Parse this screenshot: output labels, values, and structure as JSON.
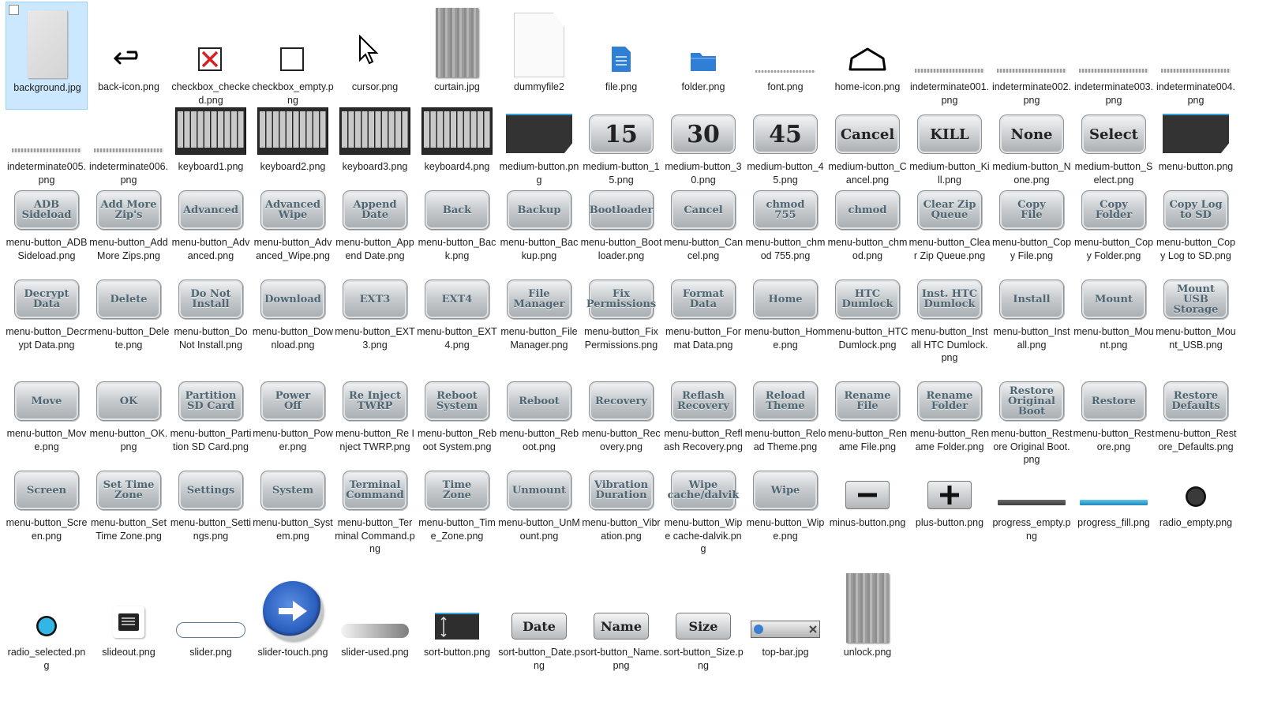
{
  "files": [
    {
      "name": "background.jpg",
      "kind": "gray-rect",
      "selected": true
    },
    {
      "name": "back-icon.png",
      "kind": "back-icon"
    },
    {
      "name": "checkbox_checked.png",
      "kind": "checkbox-checked"
    },
    {
      "name": "checkbox_empty.png",
      "kind": "checkbox-empty"
    },
    {
      "name": "cursor.png",
      "kind": "cursor"
    },
    {
      "name": "curtain.jpg",
      "kind": "curtain"
    },
    {
      "name": "dummyfile2",
      "kind": "doc"
    },
    {
      "name": "file.png",
      "kind": "file-icon"
    },
    {
      "name": "folder.png",
      "kind": "folder-icon"
    },
    {
      "name": "font.png",
      "kind": "font"
    },
    {
      "name": "home-icon.png",
      "kind": "home-icon"
    },
    {
      "name": "indeterminate001.png",
      "kind": "pattern"
    },
    {
      "name": "indeterminate002.png",
      "kind": "pattern"
    },
    {
      "name": "indeterminate003.png",
      "kind": "pattern"
    },
    {
      "name": "indeterminate004.png",
      "kind": "pattern"
    },
    {
      "name": "indeterminate005.png",
      "kind": "pattern"
    },
    {
      "name": "indeterminate006.png",
      "kind": "pattern"
    },
    {
      "name": "keyboard1.png",
      "kind": "keyboard"
    },
    {
      "name": "keyboard2.png",
      "kind": "keyboard"
    },
    {
      "name": "keyboard3.png",
      "kind": "keyboard"
    },
    {
      "name": "keyboard4.png",
      "kind": "keyboard"
    },
    {
      "name": "medium-button.png",
      "kind": "darkpanel"
    },
    {
      "name": "medium-button_15.png",
      "kind": "big",
      "text": "15"
    },
    {
      "name": "medium-button_30.png",
      "kind": "big",
      "text": "30"
    },
    {
      "name": "medium-button_45.png",
      "kind": "big",
      "text": "45"
    },
    {
      "name": "medium-button_Cancel.png",
      "kind": "big",
      "text": "Cancel"
    },
    {
      "name": "medium-button_Kill.png",
      "kind": "big",
      "text": "KILL"
    },
    {
      "name": "medium-button_None.png",
      "kind": "big",
      "text": "None"
    },
    {
      "name": "medium-button_Select.png",
      "kind": "big",
      "text": "Select"
    },
    {
      "name": "menu-button.png",
      "kind": "darkpanel"
    },
    {
      "name": "menu-button_ADB Sideload.png",
      "kind": "btn",
      "text": "ADB\nSideload"
    },
    {
      "name": "menu-button_Add More Zips.png",
      "kind": "btn",
      "text": "Add More\nZip's"
    },
    {
      "name": "menu-button_Advanced.png",
      "kind": "btn",
      "text": "Advanced"
    },
    {
      "name": "menu-button_Advanced_Wipe.png",
      "kind": "btn",
      "text": "Advanced\nWipe"
    },
    {
      "name": "menu-button_Append Date.png",
      "kind": "btn",
      "text": "Append\nDate"
    },
    {
      "name": "menu-button_Back.png",
      "kind": "btn",
      "text": "Back"
    },
    {
      "name": "menu-button_Backup.png",
      "kind": "btn",
      "text": "Backup"
    },
    {
      "name": "menu-button_Bootloader.png",
      "kind": "btn",
      "text": "Bootloader"
    },
    {
      "name": "menu-button_Cancel.png",
      "kind": "btn",
      "text": "Cancel"
    },
    {
      "name": "menu-button_chmod 755.png",
      "kind": "btn",
      "text": "chmod\n755"
    },
    {
      "name": "menu-button_chmod.png",
      "kind": "btn",
      "text": "chmod"
    },
    {
      "name": "menu-button_Clear Zip Queue.png",
      "kind": "btn",
      "text": "Clear Zip\nQueue"
    },
    {
      "name": "menu-button_Copy File.png",
      "kind": "btn",
      "text": "Copy\nFile"
    },
    {
      "name": "menu-button_Copy Folder.png",
      "kind": "btn",
      "text": "Copy\nFolder"
    },
    {
      "name": "menu-button_Copy Log to SD.png",
      "kind": "btn",
      "text": "Copy Log\nto SD"
    },
    {
      "name": "menu-button_Decrypt Data.png",
      "kind": "btn",
      "text": "Decrypt\nData"
    },
    {
      "name": "menu-button_Delete.png",
      "kind": "btn",
      "text": "Delete"
    },
    {
      "name": "menu-button_Do Not Install.png",
      "kind": "btn",
      "text": "Do Not\nInstall"
    },
    {
      "name": "menu-button_Download.png",
      "kind": "btn",
      "text": "Download"
    },
    {
      "name": "menu-button_EXT3.png",
      "kind": "btn",
      "text": "EXT3"
    },
    {
      "name": "menu-button_EXT4.png",
      "kind": "btn",
      "text": "EXT4"
    },
    {
      "name": "menu-button_File Manager.png",
      "kind": "btn",
      "text": "File\nManager"
    },
    {
      "name": "menu-button_Fix Permissions.png",
      "kind": "btn",
      "text": "Fix\nPermissions"
    },
    {
      "name": "menu-button_Format Data.png",
      "kind": "btn",
      "text": "Format\nData"
    },
    {
      "name": "menu-button_Home.png",
      "kind": "btn",
      "text": "Home"
    },
    {
      "name": "menu-button_HTC Dumlock.png",
      "kind": "btn",
      "text": "HTC\nDumlock"
    },
    {
      "name": "menu-button_Install HTC Dumlock.png",
      "kind": "btn",
      "text": "Inst. HTC\nDumlock"
    },
    {
      "name": "menu-button_Install.png",
      "kind": "btn",
      "text": "Install"
    },
    {
      "name": "menu-button_Mount.png",
      "kind": "btn",
      "text": "Mount"
    },
    {
      "name": "menu-button_Mount_USB.png",
      "kind": "btn",
      "text": "Mount\nUSB\nStorage"
    },
    {
      "name": "menu-button_Move.png",
      "kind": "btn",
      "text": "Move"
    },
    {
      "name": "menu-button_OK.png",
      "kind": "btn",
      "text": "OK"
    },
    {
      "name": "menu-button_Partition SD Card.png",
      "kind": "btn",
      "text": "Partition\nSD Card"
    },
    {
      "name": "menu-button_Power.png",
      "kind": "btn",
      "text": "Power\nOff"
    },
    {
      "name": "menu-button_Re Inject TWRP.png",
      "kind": "btn",
      "text": "Re Inject\nTWRP"
    },
    {
      "name": "menu-button_Reboot System.png",
      "kind": "btn",
      "text": "Reboot\nSystem"
    },
    {
      "name": "menu-button_Reboot.png",
      "kind": "btn",
      "text": "Reboot"
    },
    {
      "name": "menu-button_Recovery.png",
      "kind": "btn",
      "text": "Recovery"
    },
    {
      "name": "menu-button_Reflash Recovery.png",
      "kind": "btn",
      "text": "Reflash\nRecovery"
    },
    {
      "name": "menu-button_Reload Theme.png",
      "kind": "btn",
      "text": "Reload\nTheme"
    },
    {
      "name": "menu-button_Rename File.png",
      "kind": "btn",
      "text": "Rename\nFile"
    },
    {
      "name": "menu-button_Rename Folder.png",
      "kind": "btn",
      "text": "Rename\nFolder"
    },
    {
      "name": "menu-button_Restore Original Boot.png",
      "kind": "btn",
      "text": "Restore\nOriginal\nBoot"
    },
    {
      "name": "menu-button_Restore.png",
      "kind": "btn",
      "text": "Restore"
    },
    {
      "name": "menu-button_Restore_Defaults.png",
      "kind": "btn",
      "text": "Restore\nDefaults"
    },
    {
      "name": "menu-button_Screen.png",
      "kind": "btn",
      "text": "Screen"
    },
    {
      "name": "menu-button_Set Time Zone.png",
      "kind": "btn",
      "text": "Set Time\nZone"
    },
    {
      "name": "menu-button_Settings.png",
      "kind": "btn",
      "text": "Settings"
    },
    {
      "name": "menu-button_System.png",
      "kind": "btn",
      "text": "System"
    },
    {
      "name": "menu-button_Terminal Command.png",
      "kind": "btn",
      "text": "Terminal\nCommand"
    },
    {
      "name": "menu-button_Time_Zone.png",
      "kind": "btn",
      "text": "Time\nZone"
    },
    {
      "name": "menu-button_UnMount.png",
      "kind": "btn",
      "text": "Unmount"
    },
    {
      "name": "menu-button_Vibration.png",
      "kind": "btn",
      "text": "Vibration\nDuration"
    },
    {
      "name": "menu-button_Wipe cache-dalvik.png",
      "kind": "btn",
      "text": "Wipe\ncache/dalvik"
    },
    {
      "name": "menu-button_Wipe.png",
      "kind": "btn",
      "text": "Wipe"
    },
    {
      "name": "minus-button.png",
      "kind": "minus"
    },
    {
      "name": "plus-button.png",
      "kind": "plus"
    },
    {
      "name": "progress_empty.png",
      "kind": "progress-empty"
    },
    {
      "name": "progress_fill.png",
      "kind": "progress-fill"
    },
    {
      "name": "radio_empty.png",
      "kind": "radio-empty"
    },
    {
      "name": "radio_selected.png",
      "kind": "radio-selected"
    },
    {
      "name": "slideout.png",
      "kind": "slideout"
    },
    {
      "name": "slider.png",
      "kind": "slider"
    },
    {
      "name": "slider-touch.png",
      "kind": "slider-touch"
    },
    {
      "name": "slider-used.png",
      "kind": "slider-used"
    },
    {
      "name": "sort-button.png",
      "kind": "sort-dark"
    },
    {
      "name": "sort-button_Date.png",
      "kind": "sort",
      "text": "Date"
    },
    {
      "name": "sort-button_Name.png",
      "kind": "sort",
      "text": "Name"
    },
    {
      "name": "sort-button_Size.png",
      "kind": "sort",
      "text": "Size"
    },
    {
      "name": "top-bar.jpg",
      "kind": "topbar"
    },
    {
      "name": "unlock.png",
      "kind": "unlock"
    }
  ],
  "colors": {
    "button_text": "#4f6572",
    "accent_blue": "#3aa0d8",
    "selection_bg": "#cce8ff"
  }
}
